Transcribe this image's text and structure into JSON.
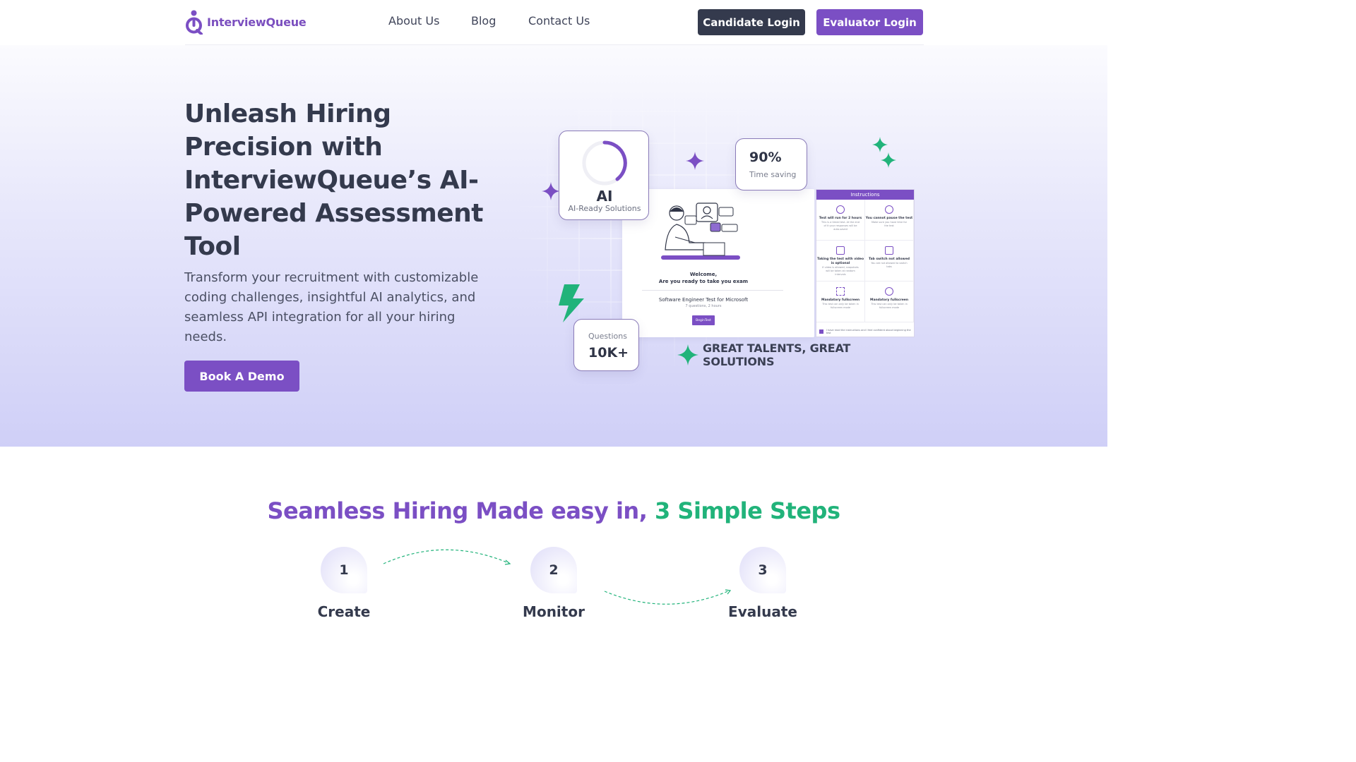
{
  "brand": {
    "name": "InterviewQueue",
    "accent": "#7b4fc4",
    "green": "#21b37a",
    "dark": "#343a4d"
  },
  "nav": {
    "items": [
      "About Us",
      "Blog",
      "Contact Us"
    ]
  },
  "header": {
    "candidate_login": "Candidate Login",
    "evaluator_login": "Evaluator Login"
  },
  "hero": {
    "title": "Unleash Hiring Precision with InterviewQueue’s AI-Powered Assessment Tool",
    "subtitle": "Transform your recruitment with customizable coding challenges, insightful AI analytics, and seamless API integration for all your hiring needs.",
    "cta": "Book A Demo",
    "tagline": "GREAT TALENTS, GREAT SOLUTIONS",
    "stats": {
      "ai_big": "AI",
      "ai_small": "AI-Ready Solutions",
      "pct_big": "90%",
      "pct_small": "Time saving",
      "q_small": "Questions",
      "q_big": "10K+"
    },
    "screen": {
      "welcome": "Welcome,",
      "ready": "Are you ready to take you exam",
      "test_name": "Software Engineer Test for Microsoft",
      "test_meta": "7 questions, 2 hours",
      "begin": "BeginTest"
    },
    "instructions": {
      "title": "Instructions",
      "items": [
        {
          "title": "Test will run for 2 hours",
          "desc": "This is a timed test. At the end of it your responses will be auto-saved"
        },
        {
          "title": "You cannot pause the test",
          "desc": "Make sure you have time for the test"
        },
        {
          "title": "Taking the test with video is optional",
          "desc": "If video is allowed, snapshots will be taken at random intervals"
        },
        {
          "title": "Tab switch not allowed",
          "desc": "You are not allowed to switch tabs"
        },
        {
          "title": "Mandatory fullscreen",
          "desc": "This test can only be taken in fullscreen mode"
        },
        {
          "title": "Mandatory fullscreen",
          "desc": "This test can only be taken in fullscreen mode"
        }
      ],
      "footer": "I have read the instructions and I feel confident about beginning the test"
    }
  },
  "steps": {
    "title_part1": "Seamless Hiring Made easy in, ",
    "title_part2": "3 Simple Steps",
    "items": [
      {
        "num": "1",
        "label": "Create"
      },
      {
        "num": "2",
        "label": "Monitor"
      },
      {
        "num": "3",
        "label": "Evaluate"
      }
    ]
  }
}
